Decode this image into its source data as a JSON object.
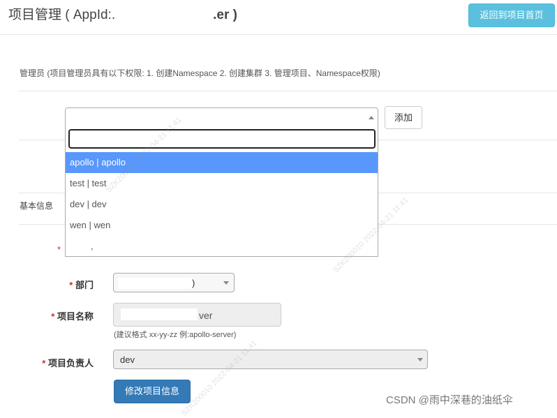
{
  "header": {
    "title_prefix": "项目管理 ( AppId:.",
    "title_suffix": ".er )",
    "back_button": "返回到项目首页"
  },
  "admin": {
    "note": "管理员 (项目管理员具有以下权限: 1. 创建Namespace 2. 创建集群 3. 管理项目、Namespace权限)",
    "add_button": "添加",
    "search_value": "",
    "options": [
      "apollo | apollo",
      "test | test",
      "dev | dev",
      "wen | wen",
      ","
    ]
  },
  "basic": {
    "section_label": "基本信息",
    "required_mark": "*",
    "dept_label": "部门",
    "dept_value_suffix": ")",
    "name_label": "项目名称",
    "name_value_suffix": "ver",
    "name_hint": "(建议格式 xx-yy-zz 例:apollo-server)",
    "owner_label": "项目负责人",
    "owner_value": "dev",
    "save_button": "修改项目信息"
  },
  "footer": {
    "text": "CSDN @雨中深巷的油纸伞"
  },
  "watermark": {
    "text": "SZK200010 2022-04-21 11:41"
  }
}
